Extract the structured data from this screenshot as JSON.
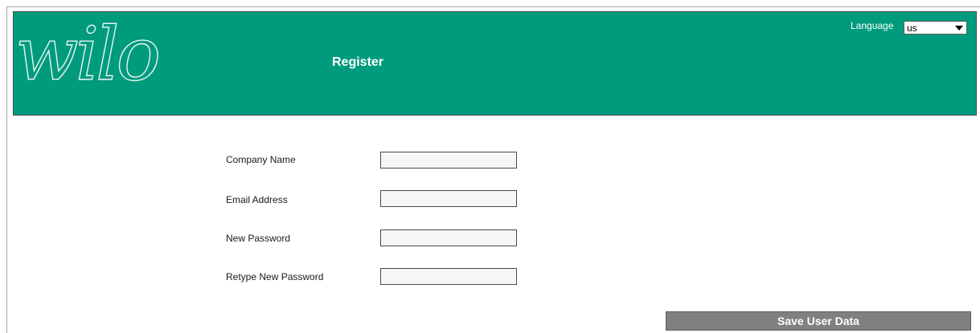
{
  "header": {
    "logo_text": "wilo",
    "title": "Register",
    "language_label": "Language",
    "language_value": "us",
    "bg_color": "#009b7d"
  },
  "form": {
    "fields": [
      {
        "label": "Company Name",
        "value": ""
      },
      {
        "label": "Email Address",
        "value": ""
      },
      {
        "label": "New Password",
        "value": ""
      },
      {
        "label": "Retype New Password",
        "value": ""
      }
    ]
  },
  "actions": {
    "save_label": "Save User Data",
    "save_color": "#808080"
  }
}
